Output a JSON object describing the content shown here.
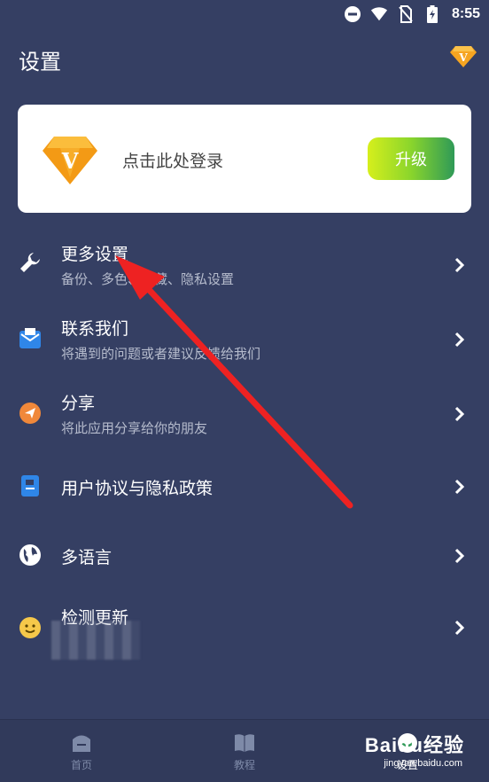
{
  "status_bar": {
    "time": "8:55",
    "icons": [
      "do-not-disturb-icon",
      "wifi-icon",
      "no-sim-icon",
      "battery-charging-icon"
    ]
  },
  "header": {
    "title": "设置",
    "vip_badge_letter": "V"
  },
  "login_card": {
    "badge_letter": "V",
    "prompt": "点击此处登录",
    "upgrade_label": "升级"
  },
  "menu": {
    "items": [
      {
        "title": "更多设置",
        "subtitle": "备份、多色、隐藏、隐私设置",
        "icon": "wrench-icon"
      },
      {
        "title": "联系我们",
        "subtitle": "将遇到的问题或者建议反馈给我们",
        "icon": "mail-icon"
      },
      {
        "title": "分享",
        "subtitle": "将此应用分享给你的朋友",
        "icon": "share-send-icon"
      },
      {
        "title": "用户协议与隐私政策",
        "subtitle": "",
        "icon": "document-icon"
      },
      {
        "title": "多语言",
        "subtitle": "",
        "icon": "globe-icon"
      },
      {
        "title": "检测更新",
        "subtitle": "",
        "icon": "smiley-icon"
      }
    ]
  },
  "bottom_nav": {
    "items": [
      {
        "label": "首页",
        "icon": "home-icon"
      },
      {
        "label": "教程",
        "icon": "book-icon"
      },
      {
        "label": "设置",
        "icon": "settings-icon"
      }
    ],
    "active": "设置"
  },
  "watermark": {
    "brand": "Baidu经验",
    "url": "jingyan.baidu.com"
  },
  "colors": {
    "background": "#353f63",
    "card": "#ffffff",
    "upgrade_gradient_start": "#d6ef1c",
    "upgrade_gradient_end": "#2f9a57",
    "annotation_arrow": "#ee2222"
  }
}
